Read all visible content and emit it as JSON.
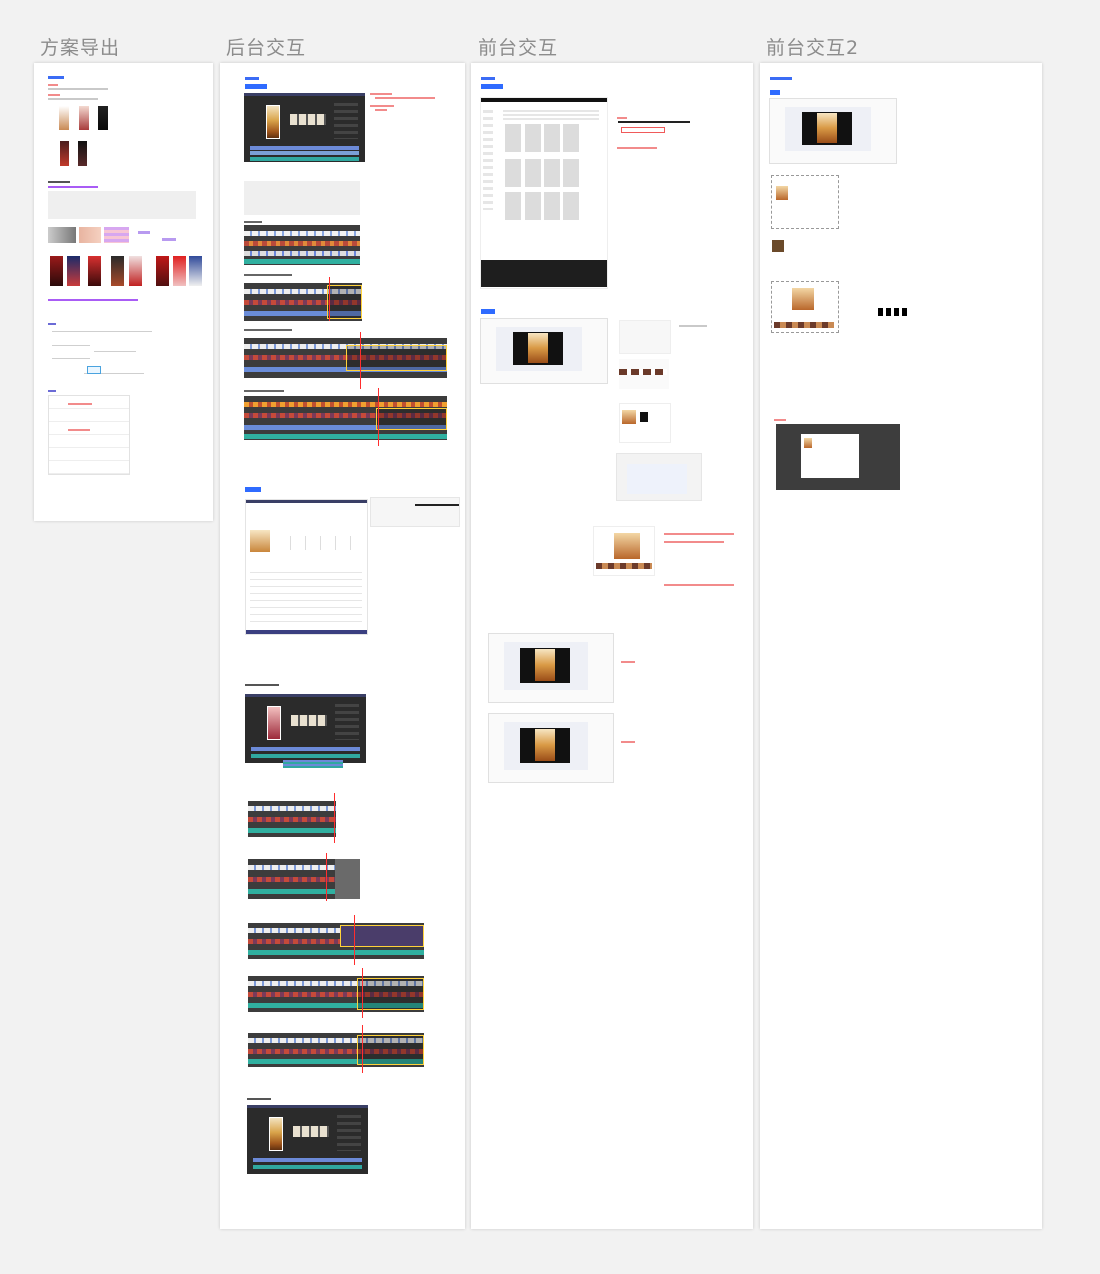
{
  "frames": [
    {
      "title": "方案导出"
    },
    {
      "title": "后台交互"
    },
    {
      "title": "前台交互"
    },
    {
      "title": "前台交互2"
    }
  ],
  "colors": {
    "canvas_bg": "#f2f2f2",
    "board_bg": "#ffffff",
    "title_gray": "#8c8c8c",
    "accent_blue": "#2f6bff",
    "annotation_red": "#ff2d2d",
    "highlight_yellow": "#ffd23a",
    "editor_dark": "#2b2b2b"
  }
}
